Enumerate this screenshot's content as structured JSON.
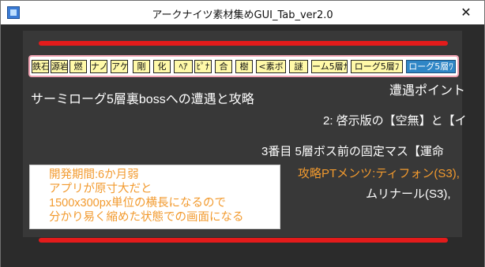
{
  "window": {
    "title": "アークナイツ素材集めGUI_Tab_ver2.0",
    "close_glyph": "✕"
  },
  "tabs": [
    {
      "label": "鉄石"
    },
    {
      "label": "源岩"
    },
    {
      "label": "燃"
    },
    {
      "label": "ナノ"
    },
    {
      "label": "アケ"
    },
    {
      "label": "剛"
    },
    {
      "label": "化"
    },
    {
      "label": "ﾍｱ"
    },
    {
      "label": "ﾋﾟﾅ"
    },
    {
      "label": "合"
    },
    {
      "label": "樹"
    },
    {
      "label": "<素ボ"
    },
    {
      "label": "謎"
    },
    {
      "label": "ーム5層ﾅ"
    },
    {
      "label": "ローグ5層ﾌ"
    },
    {
      "label": "ローグ5層ﾜ"
    }
  ],
  "content": {
    "heading": "サーミローグ5層裏bossへの遭遇と攻略",
    "encounter_point": "遭遇ポイント",
    "line2": "2: 啓示版の【空無】と【イ",
    "line3": "3番目 5層ボス前の固定マス【運命",
    "line4": "攻略PTメンツ:ティフォン(S3),",
    "line5": "ムリナール(S3),"
  },
  "note": {
    "lines": [
      "開発期間:6か月弱",
      "アプリが原寸大だと",
      "1500x300px単位の横長になるので",
      "分かり易く縮めた状態での画面になる"
    ]
  },
  "colors": {
    "accent_red": "#e31b1b",
    "tab_yellow": "#fff9a8",
    "tab_active_blue": "#2f86c6",
    "orange_text": "#f29a2e"
  }
}
